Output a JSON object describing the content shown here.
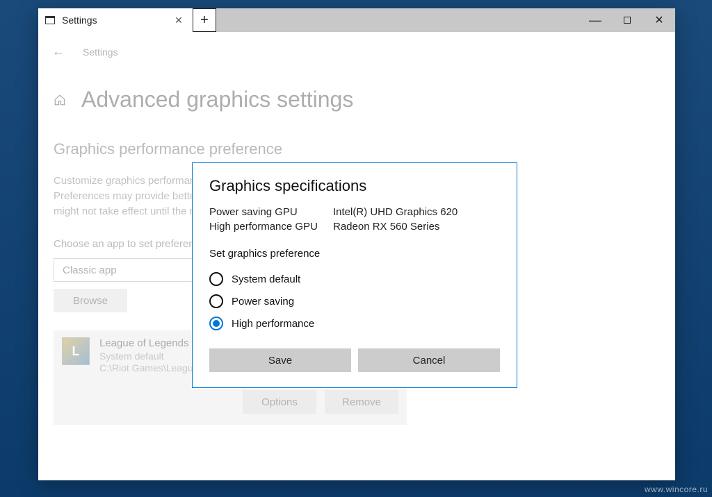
{
  "titlebar": {
    "tab_title": "Settings",
    "close_tab": "✕",
    "new_tab": "+",
    "minimize": "—",
    "close": "✕"
  },
  "breadcrumb": {
    "back": "←",
    "label": "Settings"
  },
  "page": {
    "title": "Advanced graphics settings",
    "section_heading": "Graphics performance preference",
    "description": "Customize graphics performance preference for specific applications. Preferences may provide better app performance or save battery life. Choices might not take effect until the next time the app launches.",
    "choose_label": "Choose an app to set preference",
    "dropdown_value": "Classic app",
    "browse": "Browse"
  },
  "app": {
    "name": "League of Legends",
    "pref": "System default",
    "path": "C:\\Riot Games\\League of Legends\\...",
    "options": "Options",
    "remove": "Remove"
  },
  "dialog": {
    "title": "Graphics specifications",
    "gpu1_label": "Power saving GPU",
    "gpu1_value": "Intel(R) UHD Graphics 620",
    "gpu2_label": "High performance GPU",
    "gpu2_value": "Radeon RX 560 Series",
    "pref_label": "Set graphics preference",
    "opt1": "System default",
    "opt2": "Power saving",
    "opt3": "High performance",
    "save": "Save",
    "cancel": "Cancel"
  },
  "watermark": "www.wincore.ru"
}
